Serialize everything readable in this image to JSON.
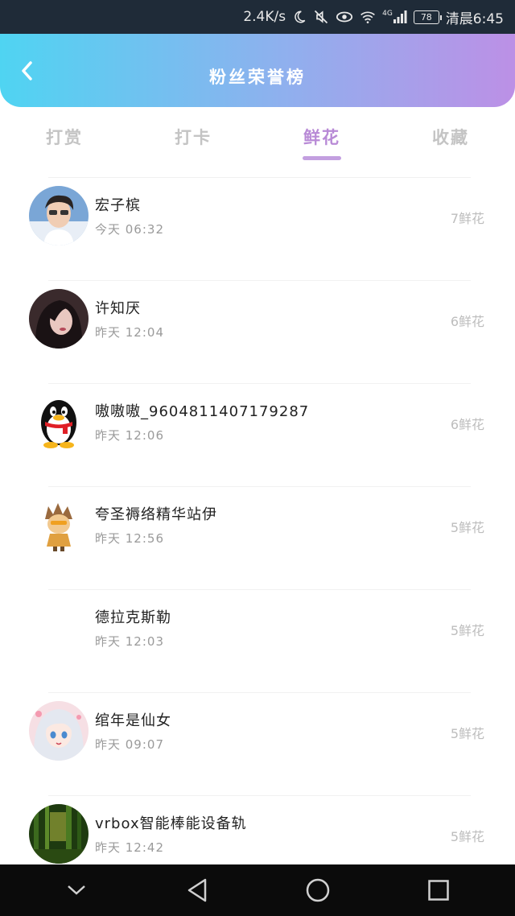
{
  "status_bar": {
    "net_speed": "2.4K/s",
    "signal_label": "4G",
    "battery": "78",
    "time": "清晨6:45"
  },
  "header": {
    "title": "粉丝荣誉榜",
    "colors": {
      "gradient_start": "#4fd4f2",
      "gradient_end": "#bc90e6"
    }
  },
  "tabs": [
    {
      "label": "打赏",
      "active": false
    },
    {
      "label": "打卡",
      "active": false
    },
    {
      "label": "鲜花",
      "active": true
    },
    {
      "label": "收藏",
      "active": false
    }
  ],
  "fans": [
    {
      "name": "宏子槟",
      "time": "今天 06:32",
      "count": "7鲜花",
      "avatar": "portrait-photo"
    },
    {
      "name": "许知厌",
      "time": "昨天 12:04",
      "count": "6鲜花",
      "avatar": "portrait-photo"
    },
    {
      "name": "嗷嗷嗷_9604811407179287",
      "time": "昨天 12:06",
      "count": "6鲜花",
      "avatar": "penguin"
    },
    {
      "name": "夸圣褥络精华站伊",
      "time": "昨天 12:56",
      "count": "5鲜花",
      "avatar": "cartoon-character"
    },
    {
      "name": "德拉克斯勒",
      "time": "昨天 12:03",
      "count": "5鲜花",
      "avatar": "none"
    },
    {
      "name": "绾年是仙女",
      "time": "昨天 09:07",
      "count": "5鲜花",
      "avatar": "anime-girl"
    },
    {
      "name": "vrbox智能棒能设备轨",
      "time": "昨天 12:42",
      "count": "5鲜花",
      "avatar": "forest-photo"
    }
  ],
  "nav_bar": {
    "buttons": [
      "back-triangle-icon",
      "home-circle-icon",
      "recents-square-icon",
      "chevron-down-icon"
    ]
  }
}
